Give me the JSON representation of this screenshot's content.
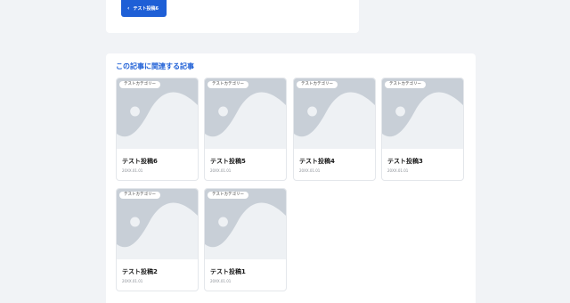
{
  "prev_nav": {
    "label": "テスト投稿6",
    "icon": "chevron-left-icon"
  },
  "related": {
    "title": "この記事に関連する記事",
    "cards": [
      {
        "category": "テストカテゴリー",
        "title": "テスト投稿6",
        "date": "20XX.01.01"
      },
      {
        "category": "テストカテゴリー",
        "title": "テスト投稿5",
        "date": "20XX.01.01"
      },
      {
        "category": "テストカテゴリー",
        "title": "テスト投稿4",
        "date": "20XX.01.01"
      },
      {
        "category": "テストカテゴリー",
        "title": "テスト投稿3",
        "date": "20XX.01.01"
      },
      {
        "category": "テストカテゴリー",
        "title": "テスト投稿2",
        "date": "20XX.01.01"
      },
      {
        "category": "テストカテゴリー",
        "title": "テスト投稿1",
        "date": "20XX.01.01"
      }
    ]
  },
  "colors": {
    "accent": "#1e5fd6",
    "page_bg": "#f1f3f6",
    "placeholder_bg": "#c8cfd7",
    "placeholder_fg": "#eef1f4"
  }
}
